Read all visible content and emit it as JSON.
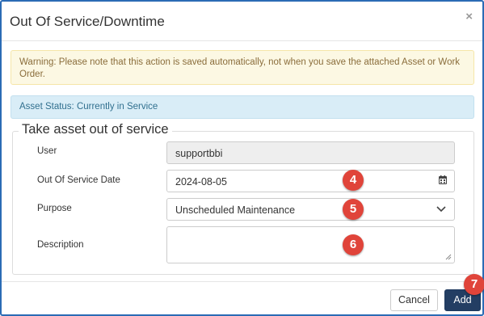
{
  "dialog": {
    "title": "Out Of Service/Downtime",
    "close_label": "×"
  },
  "alerts": {
    "warning": "Warning: Please note that this action is saved automatically, not when you save the attached Asset or Work Order.",
    "status": "Asset Status: Currently in Service"
  },
  "form": {
    "legend": "Take asset out of service",
    "user": {
      "label": "User",
      "value": "supportbbi"
    },
    "out_of_service_date": {
      "label": "Out Of Service Date",
      "value": "2024-08-05",
      "icon": "calendar-icon"
    },
    "purpose": {
      "label": "Purpose",
      "value": "Unscheduled Maintenance",
      "icon": "chevron-down-icon"
    },
    "description": {
      "label": "Description",
      "value": ""
    }
  },
  "badges": {
    "b4": "4",
    "b5": "5",
    "b6": "6",
    "b7": "7"
  },
  "footer": {
    "cancel_label": "Cancel",
    "add_label": "Add"
  },
  "colors": {
    "accent": "#233e63",
    "frame_border": "#2b6bb5",
    "warning_bg": "#fcf8e3",
    "info_bg": "#d9edf7",
    "badge": "#e0443a"
  }
}
